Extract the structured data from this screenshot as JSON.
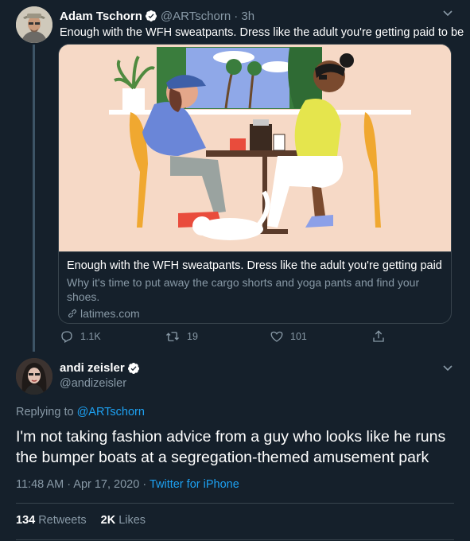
{
  "tweet": {
    "author_name": "Adam Tschorn",
    "author_handle": "@ARTschorn",
    "time": "· 3h",
    "text": "Enough with the WFH sweatpants. Dress like the adult you're getting paid to be",
    "card": {
      "title": "Enough with the WFH sweatpants. Dress like the adult you're getting paid to...",
      "description": "Why it's time to put away the cargo shorts and yoga pants and find your shoes.",
      "domain": "latimes.com"
    },
    "actions": {
      "replies": "1.1K",
      "retweets": "19",
      "likes": "101"
    }
  },
  "reply": {
    "author_name": "andi zeisler",
    "author_handle": "@andizeisler",
    "replying_prefix": "Replying to",
    "replying_to": "@ARTschorn",
    "text": "I'm not taking fashion advice from a guy who looks like he runs the bumper boats at a segregation-themed amusement park",
    "time": "11:48 AM · Apr 17, 2020 · ",
    "source": "Twitter for iPhone",
    "retweet_count": "134",
    "retweet_label": "Retweets",
    "like_count": "2K",
    "like_label": "Likes"
  },
  "colors": {
    "background": "#15202b",
    "muted": "#8899a6",
    "accent": "#1da1f2",
    "border": "#38444d"
  },
  "icons": [
    "verified-icon",
    "chevron-down-icon",
    "link-icon",
    "reply-icon",
    "retweet-icon",
    "like-icon",
    "share-icon"
  ]
}
